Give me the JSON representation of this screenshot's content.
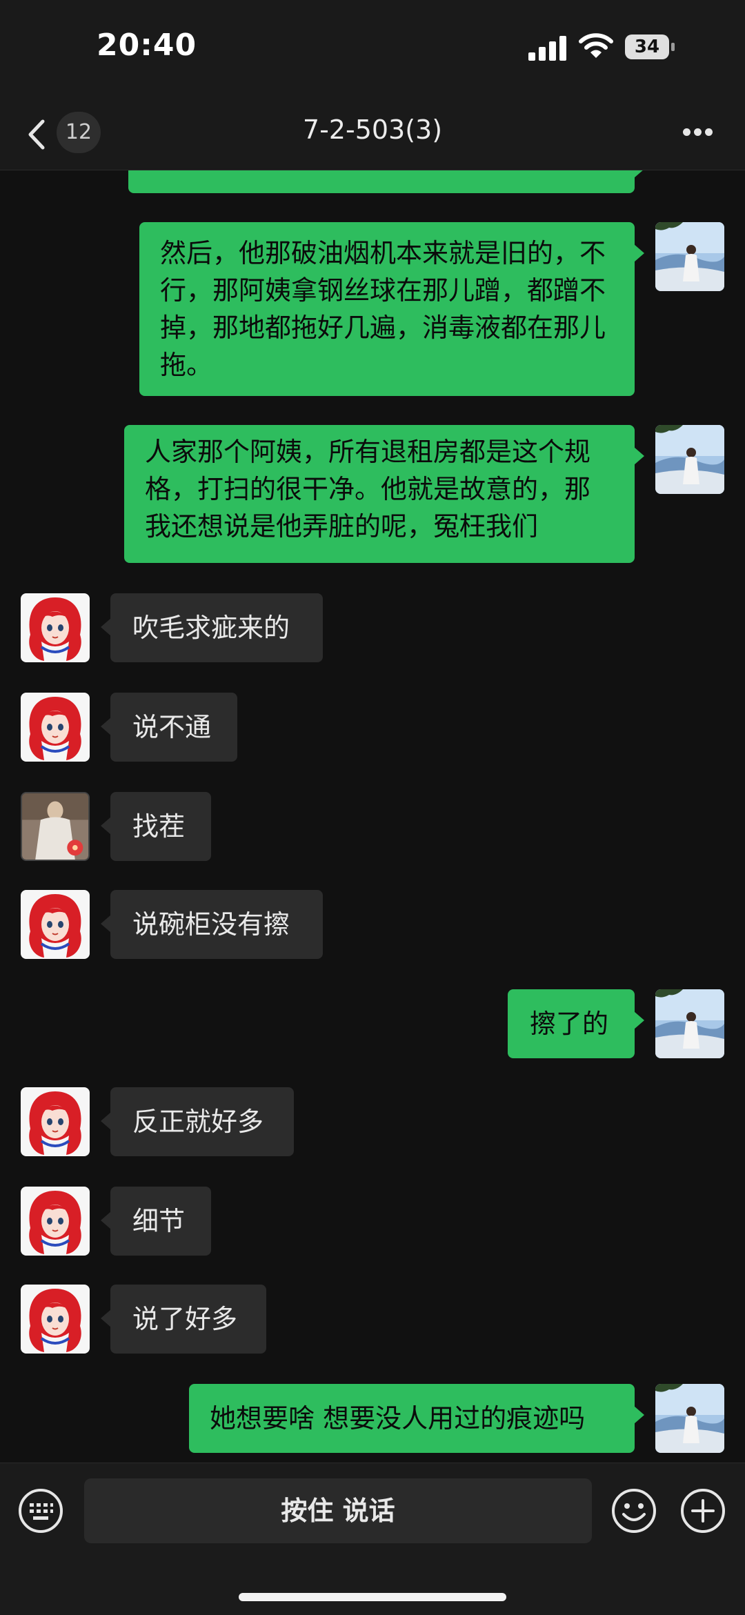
{
  "status_bar": {
    "time": "20:40",
    "battery": "34"
  },
  "nav": {
    "unread_count": "12",
    "title": "7-2-503(3)"
  },
  "messages": [
    {
      "text": "然后，他那破油烟机本来就是旧的，不行，那阿姨拿钢丝球在那儿蹭，都蹭不掉，那地都拖好几遍，消毒液都在那儿拖。"
    },
    {
      "text": "人家那个阿姨，所有退租房都是这个规格，打扫的很干净。他就是故意的，那我还想说是他弄脏的呢，冤枉我们"
    },
    {
      "text": "吹毛求疵来的"
    },
    {
      "text": "说不通"
    },
    {
      "text": "找茬"
    },
    {
      "text": "说碗柜没有擦"
    },
    {
      "text": "擦了的"
    },
    {
      "text": "反正就好多"
    },
    {
      "text": "细节"
    },
    {
      "text": "说了好多"
    },
    {
      "text": "她想要啥 想要没人用过的痕迹吗"
    }
  ],
  "input_bar": {
    "voice_label": "按住 说话"
  },
  "icons": {
    "back": "chevron-left-icon",
    "more": "more-dots-icon",
    "keyboard": "keyboard-icon",
    "emoji": "emoji-icon",
    "plus": "plus-icon"
  },
  "colors": {
    "outgoing_bubble": "#2ebd5e",
    "incoming_bubble": "#2c2c2c",
    "background": "#111111"
  }
}
